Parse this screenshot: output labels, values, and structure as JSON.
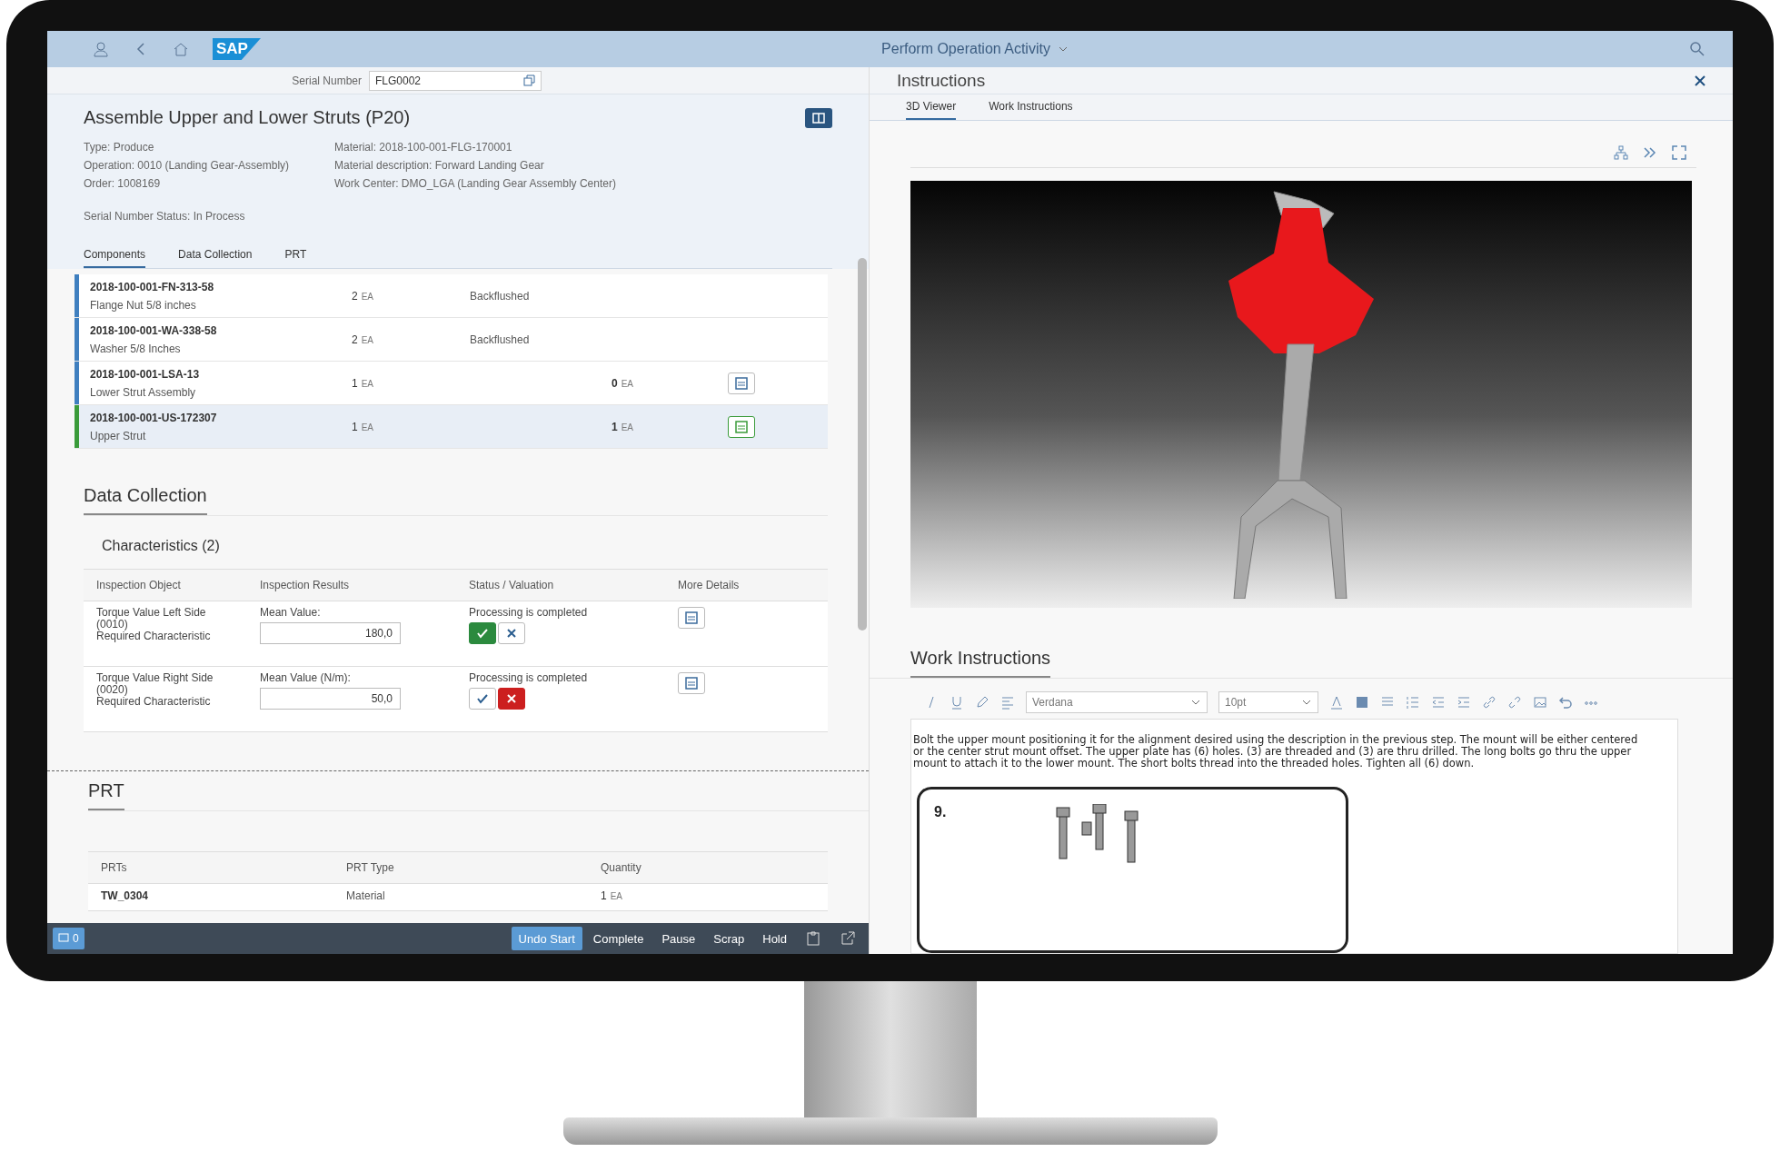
{
  "shell": {
    "logo": "SAP",
    "title": "Perform Operation Activity"
  },
  "serial_number": {
    "label": "Serial Number",
    "value": "FLG0002"
  },
  "header": {
    "title": "Assemble Upper and Lower Struts (P20)",
    "details_left": [
      "Type: Produce",
      "Operation: 0010 (Landing Gear-Assembly)",
      "Order: 1008169"
    ],
    "details_right": [
      "Material: 2018-100-001-FLG-170001",
      "Material description: Forward Landing Gear",
      "Work Center: DMO_LGA (Landing Gear Assembly Center)"
    ],
    "status": "Serial Number Status: In Process"
  },
  "tabs": [
    {
      "label": "Components",
      "selected": true
    },
    {
      "label": "Data Collection",
      "selected": false
    },
    {
      "label": "PRT",
      "selected": false
    }
  ],
  "components": [
    {
      "kind": "backflush",
      "id": "2018-100-001-FN-313-58",
      "name": "Flange Nut 5/8 inches",
      "quantity": "2",
      "unit": "EA",
      "status": "Backflushed",
      "color": "#3f7fbf",
      "selected": false
    },
    {
      "kind": "backflush",
      "id": "2018-100-001-WA-338-58",
      "name": "Washer 5/8 Inches",
      "quantity": "2",
      "unit": "EA",
      "status": "Backflushed",
      "color": "#3f7fbf",
      "selected": false
    },
    {
      "kind": "assemble",
      "id": "2018-100-001-LSA-13",
      "name": "Lower Strut Assembly",
      "quantity": "1",
      "unit": "EA",
      "consumed": "0",
      "consumed_unit": "EA",
      "color": "#3f7fbf",
      "selected": false
    },
    {
      "kind": "assemble",
      "id": "2018-100-001-US-172307",
      "name": "Upper Strut",
      "quantity": "1",
      "unit": "EA",
      "consumed": "1",
      "consumed_unit": "EA",
      "color": "#3a9b3a",
      "selected": true
    }
  ],
  "data_collection": {
    "title": "Data Collection",
    "characteristics_title": "Characteristics (2)",
    "columns": [
      "Inspection Object",
      "Inspection Results",
      "Status / Valuation",
      "More Details"
    ],
    "rows": [
      {
        "object": "Torque Value Left Side",
        "object_code": "(0010)",
        "requirement": "Required Characteristic",
        "result_label": "Mean Value:",
        "result_value": "180,0",
        "status": "Processing is completed",
        "accepted": true,
        "rejected": false
      },
      {
        "object": "Torque Value Right Side",
        "object_code": "(0020)",
        "requirement": "Required Characteristic",
        "result_label": "Mean Value (N/m):",
        "result_value": "50,0",
        "status": "Processing is completed",
        "accepted": false,
        "rejected": true
      }
    ]
  },
  "prt": {
    "title": "PRT",
    "columns": [
      "PRTs",
      "PRT Type",
      "Quantity"
    ],
    "rows": [
      {
        "prt": "TW_0304",
        "type": "Material",
        "quantity": "1",
        "unit": "EA"
      }
    ]
  },
  "footer": {
    "message_count": "0",
    "actions": [
      {
        "label": "Undo Start",
        "primary": true
      },
      {
        "label": "Complete",
        "primary": false
      },
      {
        "label": "Pause",
        "primary": false
      },
      {
        "label": "Scrap",
        "primary": false
      },
      {
        "label": "Hold",
        "primary": false
      }
    ]
  },
  "instructions": {
    "title": "Instructions",
    "tabs": [
      {
        "label": "3D Viewer",
        "selected": true
      },
      {
        "label": "Work Instructions",
        "selected": false
      }
    ],
    "work_title": "Work Instructions",
    "font": "Verdana",
    "font_size": "10pt",
    "text": "Bolt the upper mount positioning it for the alignment desired using the description in the previous step. The mount will be either centered or the center strut mount offset. The upper plate has (6) holes. (3) are threaded and (3) are thru drilled. The long bolts go thru the upper mount to attach it to the lower mount. The short bolts thread into the threaded holes. Tighten all (6) down.",
    "step_number": "9."
  }
}
